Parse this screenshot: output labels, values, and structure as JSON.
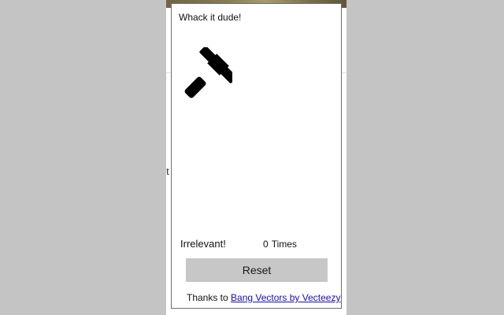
{
  "popup": {
    "title": "Whack it dude!",
    "hammer_icon": "gavel-icon",
    "status_label": "Irrelevant!",
    "count": "0",
    "count_unit": "Times",
    "reset_label": "Reset",
    "credit_prefix": "Thanks to",
    "credit_link": "Bang Vectors by Vecteezy"
  },
  "background_page": {
    "visible_fragment": "t"
  },
  "colors": {
    "backdrop": "#c4c4c4",
    "button_bg": "#c7c7c7",
    "link": "#1a0dab"
  }
}
